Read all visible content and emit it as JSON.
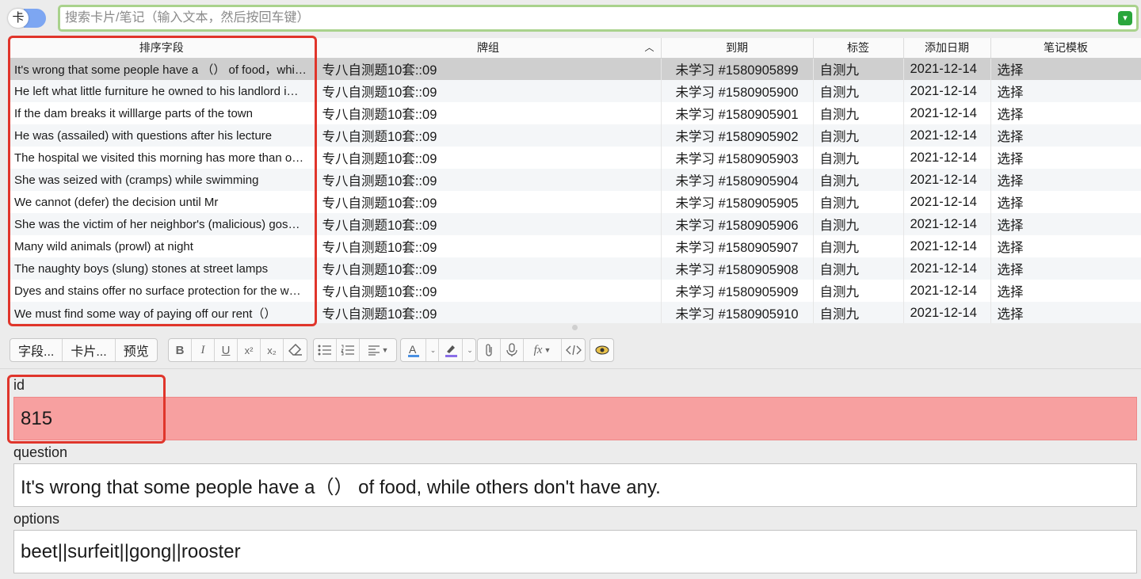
{
  "search": {
    "toggle_label": "卡",
    "placeholder": "搜索卡片/笔记（输入文本，然后按回车键）"
  },
  "table": {
    "columns": [
      "排序字段",
      "牌组",
      "到期",
      "标签",
      "添加日期",
      "笔记模板"
    ],
    "sort_indicator": "^",
    "rows": [
      {
        "sort": "It's wrong that some people have a （）  of food，whi…",
        "deck": "专八自测题10套::09",
        "due": "未学习 #1580905899",
        "tag": "自测九",
        "added": "2021-12-14",
        "model": "选择"
      },
      {
        "sort": "He left what little furniture he owned to his landlord i…",
        "deck": "专八自测题10套::09",
        "due": "未学习 #1580905900",
        "tag": "自测九",
        "added": "2021-12-14",
        "model": "选择"
      },
      {
        "sort": "If the dam breaks it willlarge parts of the town",
        "deck": "专八自测题10套::09",
        "due": "未学习 #1580905901",
        "tag": "自测九",
        "added": "2021-12-14",
        "model": "选择"
      },
      {
        "sort": "He was (assailed) with questions after his lecture",
        "deck": "专八自测题10套::09",
        "due": "未学习 #1580905902",
        "tag": "自测九",
        "added": "2021-12-14",
        "model": "选择"
      },
      {
        "sort": "The hospital we visited this morning has more than o…",
        "deck": "专八自测题10套::09",
        "due": "未学习 #1580905903",
        "tag": "自测九",
        "added": "2021-12-14",
        "model": "选择"
      },
      {
        "sort": "She was seized with (cramps) while swimming",
        "deck": "专八自测题10套::09",
        "due": "未学习 #1580905904",
        "tag": "自测九",
        "added": "2021-12-14",
        "model": "选择"
      },
      {
        "sort": "We cannot (defer) the decision until Mr",
        "deck": "专八自测题10套::09",
        "due": "未学习 #1580905905",
        "tag": "自测九",
        "added": "2021-12-14",
        "model": "选择"
      },
      {
        "sort": "She was the victim of her neighbor's (malicious) gos…",
        "deck": "专八自测题10套::09",
        "due": "未学习 #1580905906",
        "tag": "自测九",
        "added": "2021-12-14",
        "model": "选择"
      },
      {
        "sort": "Many wild animals (prowl) at night",
        "deck": "专八自测题10套::09",
        "due": "未学习 #1580905907",
        "tag": "自测九",
        "added": "2021-12-14",
        "model": "选择"
      },
      {
        "sort": "The naughty boys (slung) stones at street lamps",
        "deck": "专八自测题10套::09",
        "due": "未学习 #1580905908",
        "tag": "自测九",
        "added": "2021-12-14",
        "model": "选择"
      },
      {
        "sort": "Dyes and stains offer no surface protection for the w…",
        "deck": "专八自测题10套::09",
        "due": "未学习 #1580905909",
        "tag": "自测九",
        "added": "2021-12-14",
        "model": "选择"
      },
      {
        "sort": "We must find some way of paying off our rent（）",
        "deck": "专八自测题10套::09",
        "due": "未学习 #1580905910",
        "tag": "自测九",
        "added": "2021-12-14",
        "model": "选择"
      }
    ]
  },
  "toolbar": {
    "fields_label": "字段...",
    "cards_label": "卡片...",
    "preview_label": "预览",
    "bold": "B",
    "italic": "I",
    "underline": "U",
    "superscript": "x²",
    "subscript": "x₂",
    "mathjax": "fx"
  },
  "editor": {
    "fields": [
      {
        "name": "id",
        "value": "815"
      },
      {
        "name": "question",
        "value": "It's wrong that some people have a（）  of food, while others don't have any."
      },
      {
        "name": "options",
        "value": "beet||surfeit||gong||rooster"
      }
    ]
  },
  "colors": {
    "search_border": "#a9d28c",
    "highlight_red": "#e0352b",
    "duplicate_field": "#f7a0a0",
    "selected_row": "#cfcfcf"
  }
}
